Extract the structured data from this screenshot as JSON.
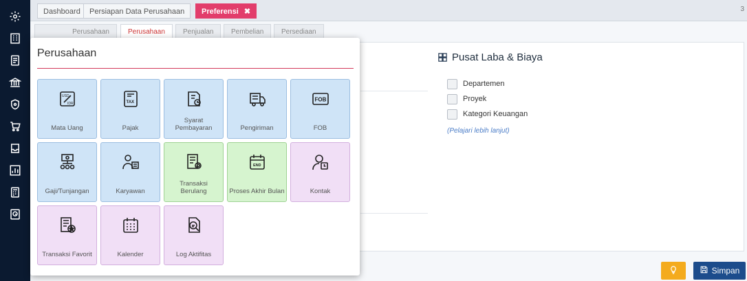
{
  "sidebar": {
    "icons": [
      "settings-icon",
      "building-icon",
      "document-icon",
      "bank-icon",
      "shield-icon",
      "cart-icon",
      "inbox-icon",
      "chart-icon",
      "calculator-icon",
      "report-icon"
    ]
  },
  "tabs": {
    "items": [
      "Dashboard",
      "Persiapan Data Perusahaan",
      "Preferensi"
    ],
    "close_glyph": "✖",
    "corner": "3"
  },
  "subtabs": [
    "Perusahaan",
    "Perusahaan",
    "Penjualan",
    "Pembelian",
    "Persediaan"
  ],
  "profit_center": {
    "title": "Pusat Laba & Biaya",
    "options": [
      "Departemen",
      "Proyek",
      "Kategori Keuangan"
    ],
    "link": "(Pelajari lebih lanjut)"
  },
  "buttons": {
    "save_label": "Simpan"
  },
  "popup": {
    "title": "Perusahaan",
    "tiles": [
      {
        "label": "Mata Uang",
        "color": "blue"
      },
      {
        "label": "Pajak",
        "color": "blue"
      },
      {
        "label": "Syarat Pembayaran",
        "color": "blue"
      },
      {
        "label": "Pengiriman",
        "color": "blue"
      },
      {
        "label": "FOB",
        "color": "blue"
      },
      {
        "label": "Gaji/Tunjangan",
        "color": "blue"
      },
      {
        "label": "Karyawan",
        "color": "blue"
      },
      {
        "label": "Transaksi Berulang",
        "color": "green"
      },
      {
        "label": "Proses Akhir Bulan",
        "color": "green"
      },
      {
        "label": "Kontak",
        "color": "purple"
      },
      {
        "label": "Transaksi Favorit",
        "color": "purple"
      },
      {
        "label": "Kalender",
        "color": "purple"
      },
      {
        "label": "Log Aktifitas",
        "color": "purple"
      }
    ]
  },
  "colors": {
    "accent": "#e23d6b",
    "sidebar": "#0b1a30",
    "save": "#1c4c8c",
    "warning": "#f4ab1d"
  }
}
